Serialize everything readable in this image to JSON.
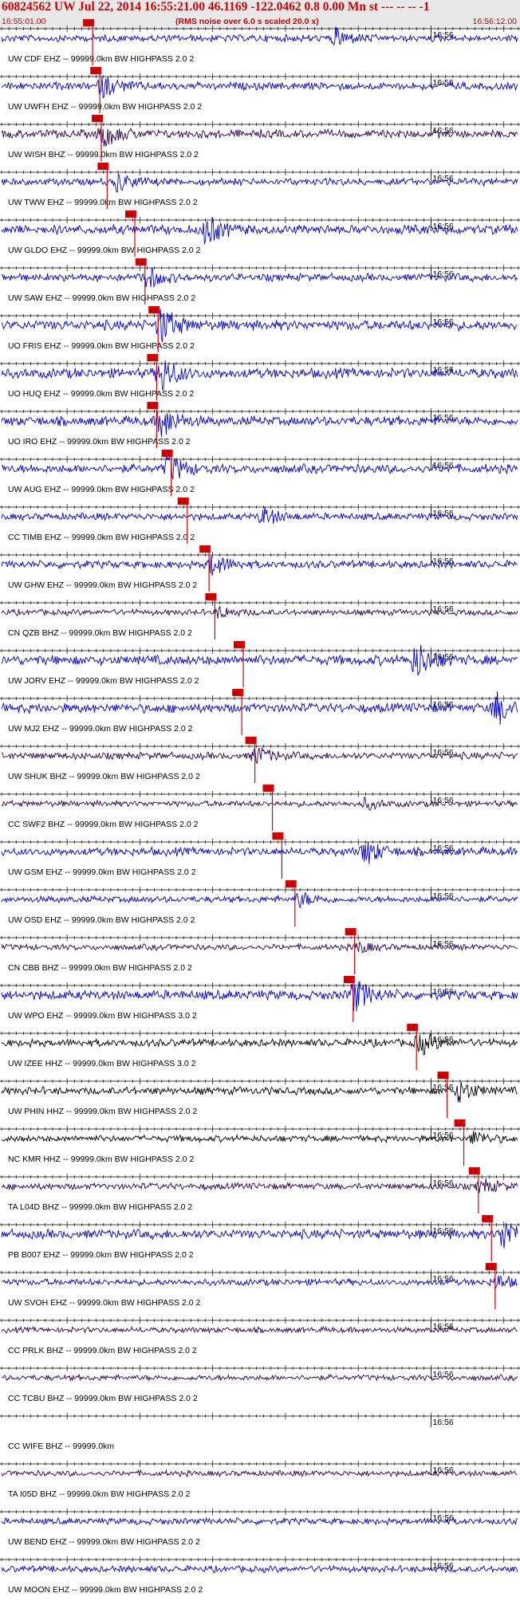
{
  "header": {
    "title": "60824562 UW Jul 22, 2014 16:55:21.00   46.1169 -122.0462  0.8 0.00 Mn st --- -- --  -1",
    "start_time": "16:55:01.00",
    "note": "(RMS noise over 6.0 s scaled 20.0 x)",
    "end_time": "16:56:12.00",
    "bg_color": "#e8e8e8",
    "text_color": "#d20000"
  },
  "chart_data": {
    "type": "seismogram",
    "time_range": [
      "16:55:01.00",
      "16:56:12.00"
    ],
    "tick_label": "16:56",
    "pick_label": "x:1",
    "colors": {
      "blue": "#0000dd",
      "purple": "#2a0055",
      "black": "#000000",
      "pick": "#e00000",
      "axis": "#000000"
    },
    "traces": [
      {
        "label": "UW CDF EHZ -- 99999.0km BW  HIGHPASS  2.0  2",
        "pick_s": 12.5,
        "color": "blue",
        "event_s": 46,
        "amp": 0.5
      },
      {
        "label": "UW UWFH EHZ -- 99999.0km BW  HIGHPASS  2.0  2",
        "pick_s": 13.5,
        "color": "blue",
        "event_s": 14,
        "amp": 0.6
      },
      {
        "label": "UW WISH BHZ -- 99999.0km BW  HIGHPASS  2.0  2",
        "pick_s": 13.7,
        "color": "purple",
        "event_s": 14,
        "amp": 0.7
      },
      {
        "label": "UW TWW EHZ -- 99999.0km BW  HIGHPASS  2.0  2",
        "pick_s": 14.5,
        "color": "blue",
        "event_s": 16,
        "amp": 0.5
      },
      {
        "label": "UW GLDO EHZ -- 99999.0km BW  HIGHPASS  2.0  2",
        "pick_s": 18.3,
        "color": "blue",
        "event_s": 28,
        "amp": 0.9
      },
      {
        "label": "UW SAW EHZ -- 99999.0km BW  HIGHPASS  2.0  2",
        "pick_s": 19.7,
        "color": "blue",
        "event_s": 20,
        "amp": 0.6
      },
      {
        "label": "UO FRIS EHZ -- 99999.0km BW  HIGHPASS  2.0  2",
        "pick_s": 21.5,
        "color": "blue",
        "event_s": 22,
        "amp": 1.0
      },
      {
        "label": "UO HUQ EHZ -- 99999.0km BW  HIGHPASS  2.0  2",
        "pick_s": 21.3,
        "color": "blue",
        "event_s": 22,
        "amp": 1.0
      },
      {
        "label": "UO IRO EHZ -- 99999.0km BW  HIGHPASS  2.0  2",
        "pick_s": 21.3,
        "color": "blue",
        "event_s": 22,
        "amp": 0.9
      },
      {
        "label": "UW AUG EHZ -- 99999.0km BW  HIGHPASS  2.0  2",
        "pick_s": 23.3,
        "color": "blue",
        "event_s": 23,
        "amp": 0.8
      },
      {
        "label": "CC TIMB EHZ -- 99999.0km BW  HIGHPASS  2.0  2",
        "pick_s": 25.5,
        "color": "blue",
        "event_s": 36,
        "amp": 0.5
      },
      {
        "label": "UW GHW EHZ -- 99999.0km BW  HIGHPASS  2.0  2",
        "pick_s": 28.5,
        "color": "blue",
        "event_s": 29,
        "amp": 0.6
      },
      {
        "label": "CN QZB BHZ -- 99999.0km BW  HIGHPASS  2.0  2",
        "pick_s": 29.3,
        "color": "purple",
        "event_s": 30,
        "amp": 0.3
      },
      {
        "label": "UW JORV EHZ -- 99999.0km BW  HIGHPASS  2.0  2",
        "pick_s": 33.2,
        "color": "blue",
        "event_s": 57,
        "amp": 1.0
      },
      {
        "label": "UW MJ2 EHZ -- 99999.0km BW  HIGHPASS  2.0  2",
        "pick_s": 33.0,
        "color": "blue",
        "event_s": 68,
        "amp": 0.9
      },
      {
        "label": "UW SHUK BHZ -- 99999.0km BW  HIGHPASS  2.0  2",
        "pick_s": 34.8,
        "color": "purple",
        "event_s": 35,
        "amp": 0.5
      },
      {
        "label": "CC SWF2 BHZ -- 99999.0km BW  HIGHPASS  2.0  2",
        "pick_s": 37.2,
        "color": "purple",
        "event_s": 50,
        "amp": 0.3
      },
      {
        "label": "UW GSM EHZ -- 99999.0km BW  HIGHPASS  2.0  2",
        "pick_s": 38.5,
        "color": "blue",
        "event_s": 50,
        "amp": 0.7
      },
      {
        "label": "UW OSD EHZ -- 99999.0km BW  HIGHPASS  2.0  2",
        "pick_s": 40.3,
        "color": "blue",
        "event_s": 41,
        "amp": 0.4
      },
      {
        "label": "CN CBB BHZ -- 99999.0km BW  HIGHPASS  2.0  2",
        "pick_s": 48.5,
        "color": "purple",
        "event_s": 49,
        "amp": 0.3
      },
      {
        "label": "UW WPO EHZ -- 99999.0km BW  HIGHPASS  3.0  2",
        "pick_s": 48.3,
        "color": "blue",
        "event_s": 48.5,
        "amp": 0.9
      },
      {
        "label": "UW IZEE HHZ -- 99999.0km BW  HIGHPASS  3.0  2",
        "pick_s": 57.0,
        "color": "black",
        "event_s": 57.5,
        "amp": 0.6
      },
      {
        "label": "UW PHIN HHZ -- 99999.0km BW  HIGHPASS  2.0  2",
        "pick_s": 61.2,
        "color": "black",
        "event_s": 63,
        "amp": 0.6
      },
      {
        "label": "NC KMR HHZ -- 99999.0km BW  HIGHPASS  2.0  2",
        "pick_s": 63.5,
        "color": "black",
        "event_s": 65,
        "amp": 0.4
      },
      {
        "label": "TA L04D BHZ -- 99999.0km BW  HIGHPASS  2.0  2",
        "pick_s": 65.5,
        "color": "purple",
        "event_s": 66,
        "amp": 0.4
      },
      {
        "label": "PB B007 EHZ -- 99999.0km BW  HIGHPASS  2.0  2",
        "pick_s": 67.3,
        "color": "blue",
        "event_s": 69,
        "amp": 0.9
      },
      {
        "label": "UW SVOH EHZ -- 99999.0km BW  HIGHPASS  2.0  2",
        "pick_s": 67.8,
        "color": "blue",
        "event_s": 68,
        "amp": 0.4
      },
      {
        "label": "CC PRLK BHZ -- 99999.0km BW  HIGHPASS  2.0  2",
        "pick_s": null,
        "color": "purple",
        "event_s": null,
        "amp": 0.25
      },
      {
        "label": "CC TCBU BHZ -- 99999.0km BW  HIGHPASS  2.0  2",
        "pick_s": null,
        "color": "purple",
        "event_s": null,
        "amp": 0.25
      },
      {
        "label": "CC WIFE BHZ -- 99999.0km",
        "pick_s": null,
        "color": "none",
        "event_s": null,
        "amp": 0
      },
      {
        "label": "TA I05D BHZ -- 99999.0km BW  HIGHPASS  2.0  2",
        "pick_s": null,
        "color": "purple",
        "event_s": null,
        "amp": 0.25
      },
      {
        "label": "UW BEND EHZ -- 99999.0km BW  HIGHPASS  2.0  2",
        "pick_s": null,
        "color": "blue",
        "event_s": null,
        "amp": 0.4
      },
      {
        "label": "UW MOON EHZ -- 99999.0km BW  HIGHPASS  2.0  2",
        "pick_s": null,
        "color": "blue",
        "event_s": null,
        "amp": 0.4
      }
    ]
  }
}
